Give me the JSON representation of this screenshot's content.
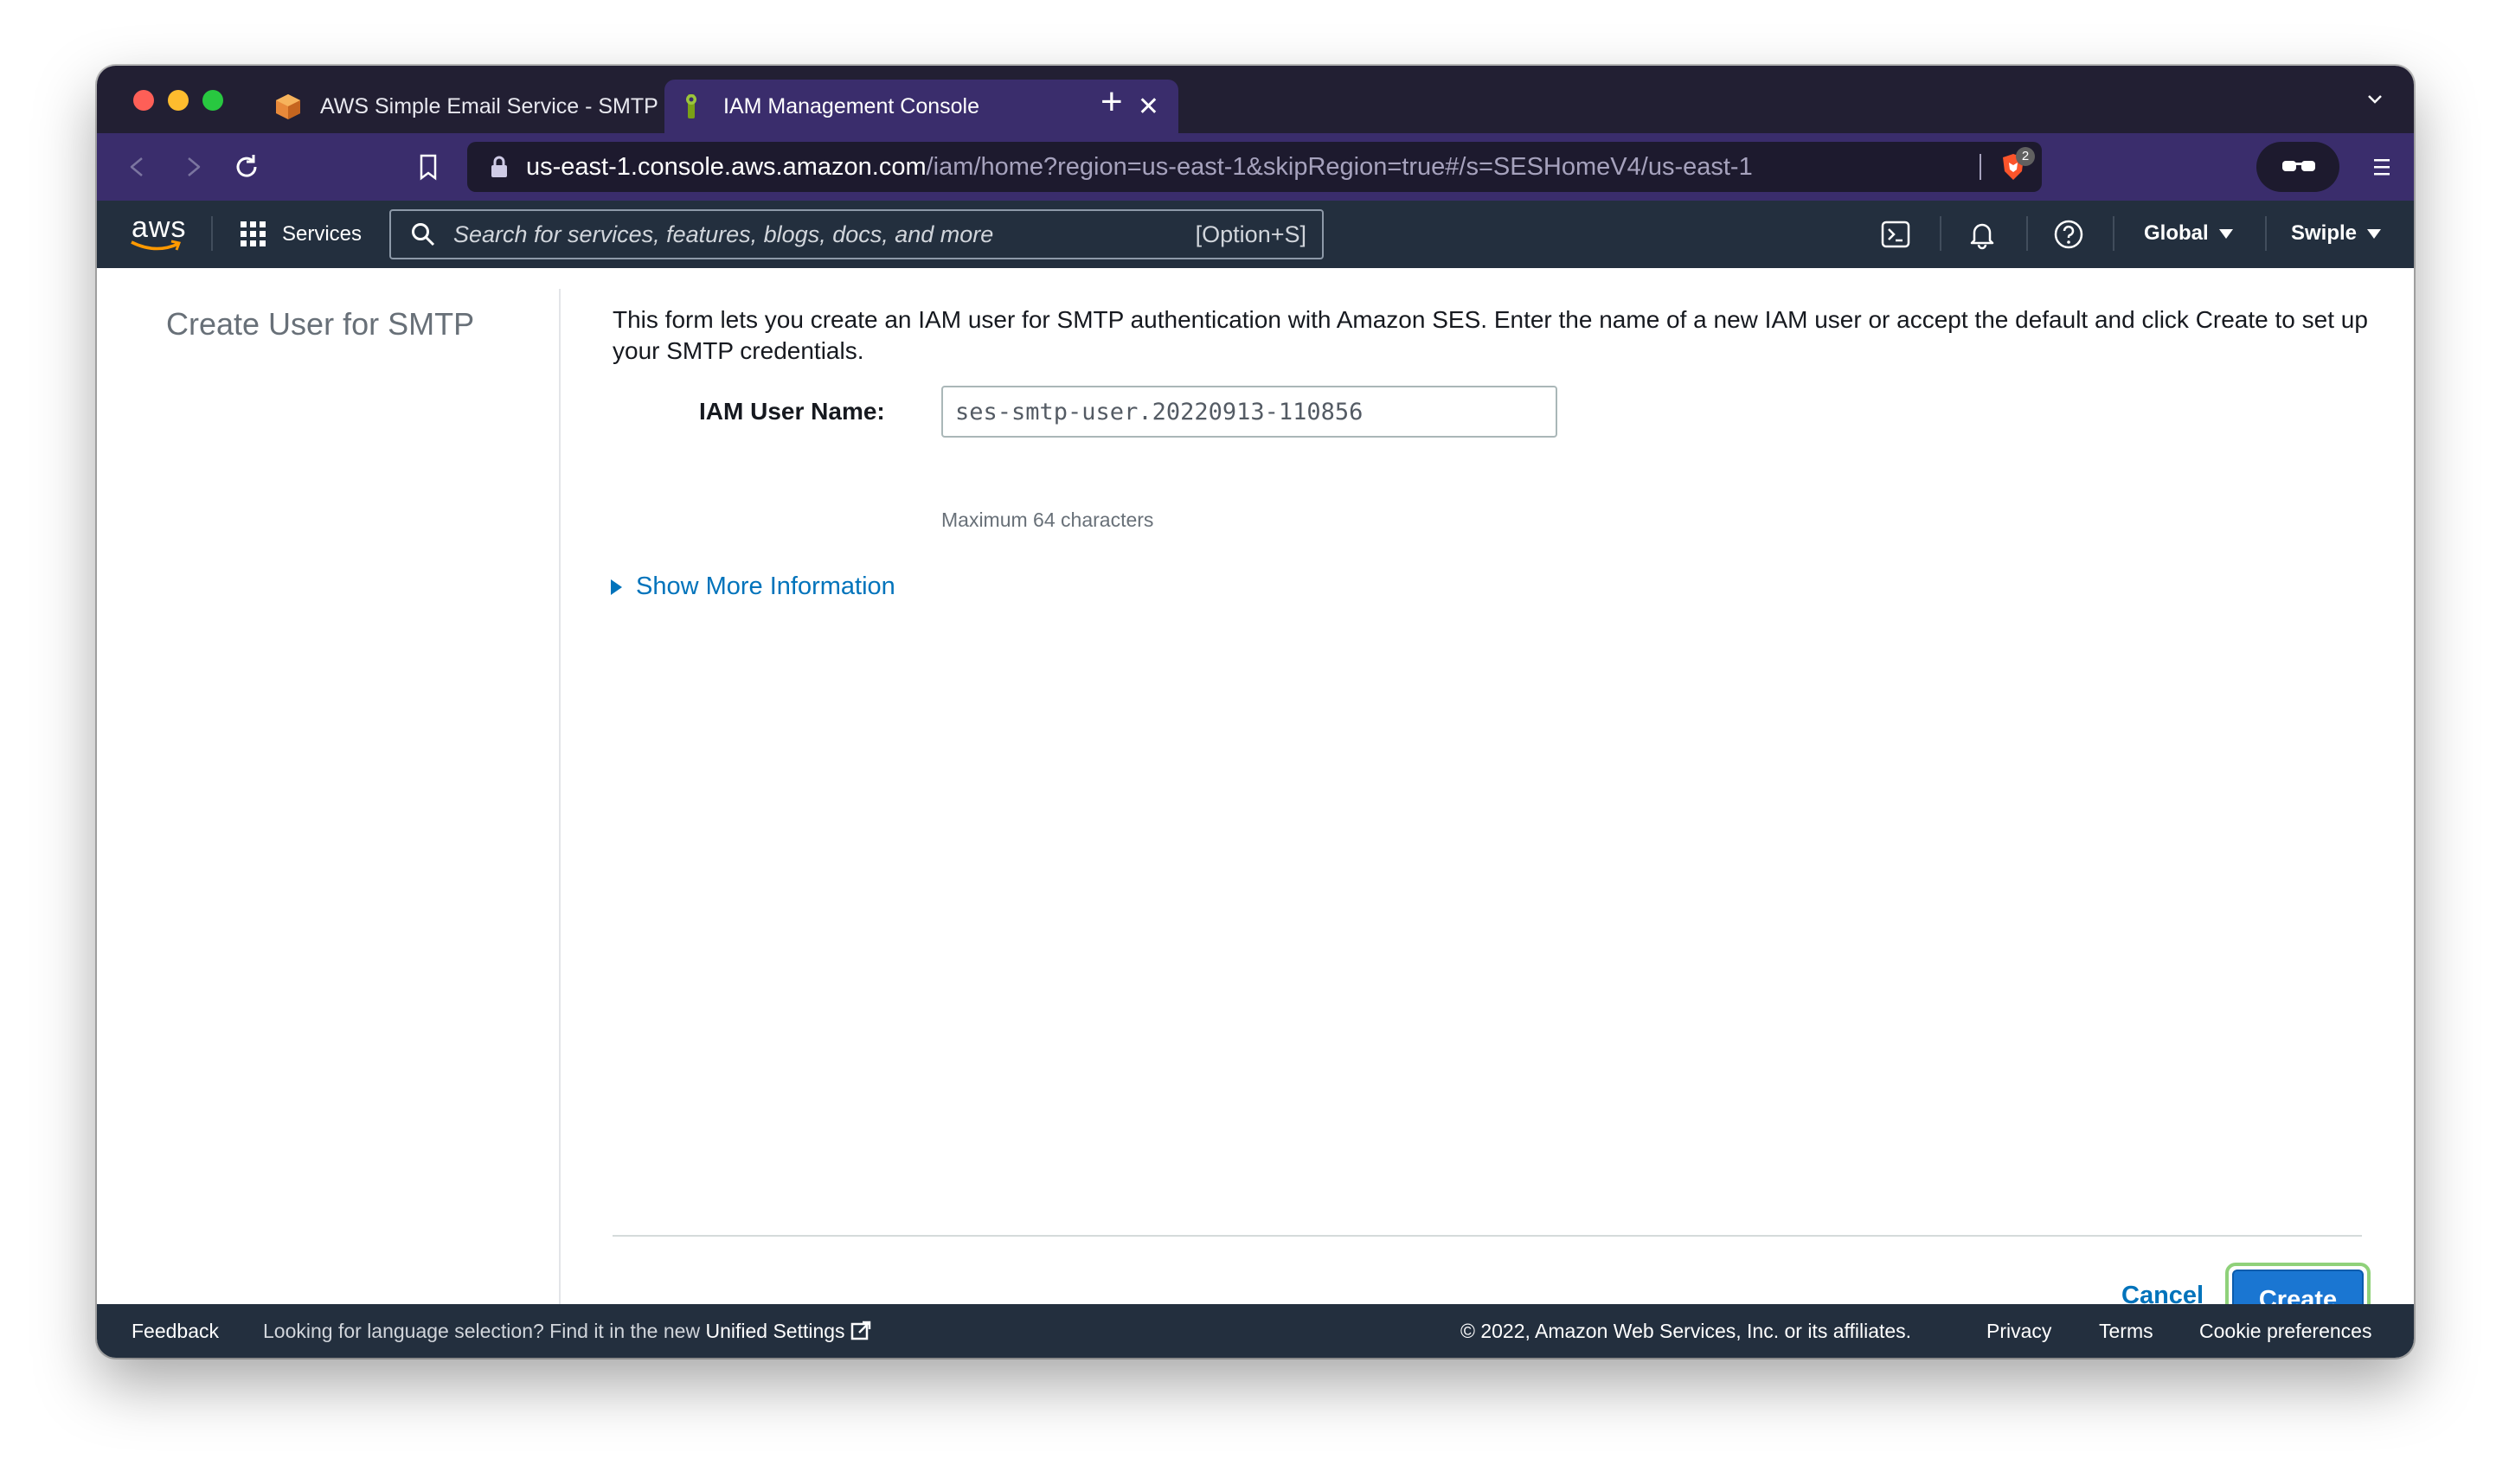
{
  "browser": {
    "tabs": [
      {
        "title": "AWS Simple Email Service - SMTP s",
        "active": false,
        "favicon": "aws-ses-cube-icon"
      },
      {
        "title": "IAM Management Console",
        "active": true,
        "favicon": "iam-icon"
      }
    ],
    "url_host": "us-east-1.console.aws.amazon.com",
    "url_path": "/iam/home?region=us-east-1&skipRegion=true#/s=SESHomeV4/us-east-1",
    "shield_count": "2"
  },
  "aws_header": {
    "logo_text": "aws",
    "services_label": "Services",
    "search_placeholder": "Search for services, features, blogs, docs, and more",
    "search_shortcut": "[Option+S]",
    "region_label": "Global",
    "account_label": "Swiple"
  },
  "page": {
    "left_title": "Create User for SMTP",
    "intro": "This form lets you create an IAM user for SMTP authentication with Amazon SES. Enter the name of a new IAM user or accept the default and click Create to set up your SMTP credentials.",
    "field_label": "IAM User Name:",
    "field_value": "ses-smtp-user.20220913-110856",
    "field_hint": "Maximum 64 characters",
    "more_info_label": "Show More Information",
    "cancel_label": "Cancel",
    "create_label": "Create"
  },
  "footer": {
    "feedback": "Feedback",
    "language_note": "Looking for language selection? Find it in the new",
    "unified_settings": "Unified Settings",
    "copyright": "© 2022, Amazon Web Services, Inc. or its affiliates.",
    "privacy": "Privacy",
    "terms": "Terms",
    "cookies": "Cookie preferences"
  },
  "colors": {
    "aws_nav": "#232f3e",
    "browser_chrome": "#3a2d6c",
    "primary_button": "#1a76d2",
    "link": "#0073bb"
  }
}
